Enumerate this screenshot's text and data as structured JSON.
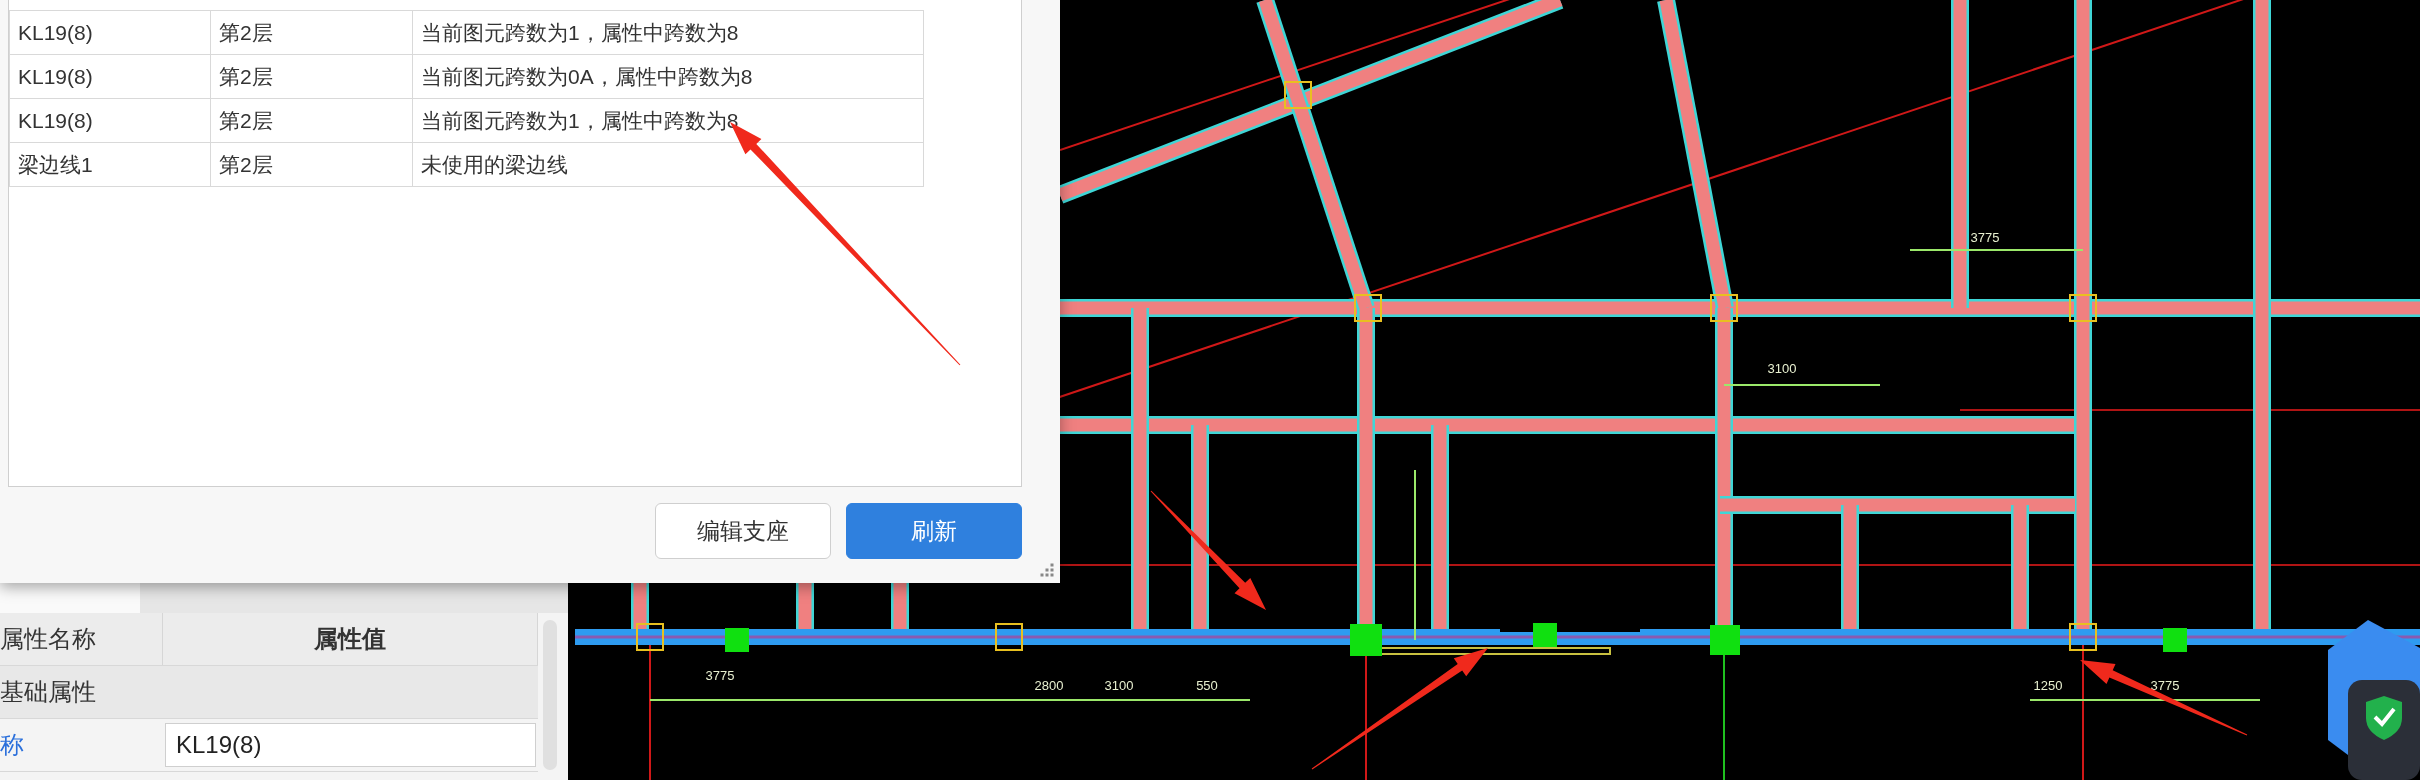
{
  "dialog": {
    "rows": [
      {
        "name": "KL19(8)",
        "floor": "第2层",
        "description": "当前图元跨数为1，属性中跨数为8"
      },
      {
        "name": "KL19(8)",
        "floor": "第2层",
        "description": "当前图元跨数为0A，属性中跨数为8"
      },
      {
        "name": "KL19(8)",
        "floor": "第2层",
        "description": "当前图元跨数为1，属性中跨数为8"
      },
      {
        "name": "梁边线1",
        "floor": "第2层",
        "description": "未使用的梁边线"
      }
    ],
    "buttons": [
      {
        "label": "编辑支座",
        "kind": "default"
      },
      {
        "label": "刷新",
        "kind": "primary"
      }
    ]
  },
  "property_panel": {
    "columns": [
      "属性名称",
      "属性值"
    ],
    "group": "基础属性",
    "rows": [
      {
        "name": "称",
        "value": "KL19(8)"
      }
    ]
  },
  "drawing": {
    "dimension_labels": [
      "3775",
      "2800",
      "3100",
      "550",
      "1250",
      "3775",
      "3775",
      "3100"
    ]
  }
}
